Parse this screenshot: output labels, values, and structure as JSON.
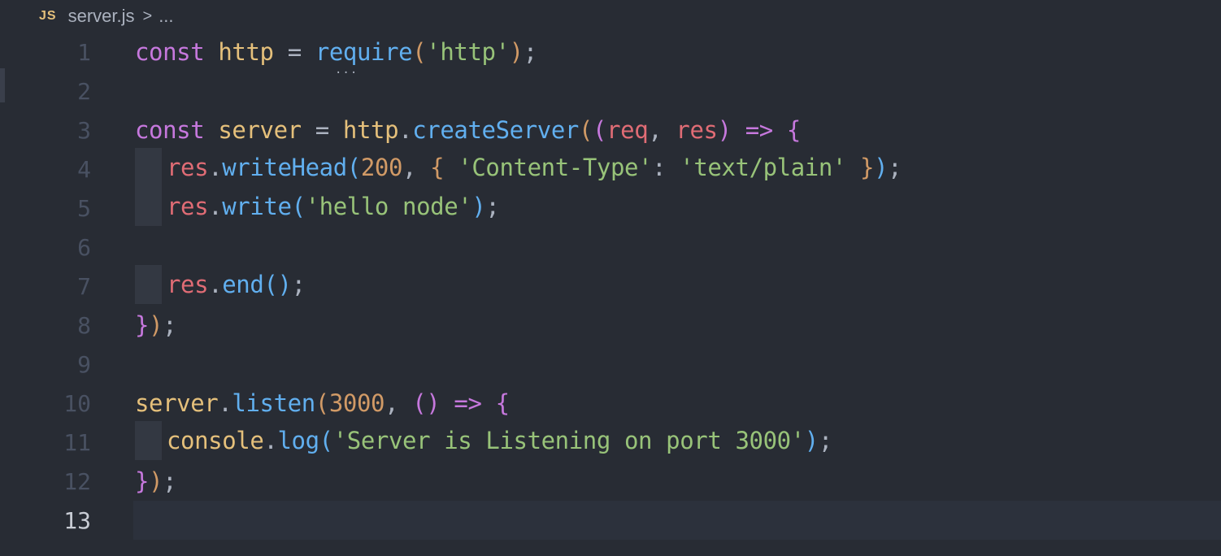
{
  "breadcrumb": {
    "file_icon": "JS",
    "file_name": "server.js",
    "separator": ">",
    "more": "..."
  },
  "editor": {
    "current_line": 13,
    "lines": [
      {
        "number": "1",
        "text": "const http = require('http');"
      },
      {
        "number": "2",
        "text": ""
      },
      {
        "number": "3",
        "text": "const server = http.createServer((req, res) => {"
      },
      {
        "number": "4",
        "text": "res.writeHead(200, { 'Content-Type': 'text/plain' });"
      },
      {
        "number": "5",
        "text": "res.write('hello node');"
      },
      {
        "number": "6",
        "text": ""
      },
      {
        "number": "7",
        "text": "res.end();"
      },
      {
        "number": "8",
        "text": "});"
      },
      {
        "number": "9",
        "text": ""
      },
      {
        "number": "10",
        "text": "server.listen(3000, () => {"
      },
      {
        "number": "11",
        "text": "console.log('Server is Listening on port 3000');"
      },
      {
        "number": "12",
        "text": "});"
      },
      {
        "number": "13",
        "text": ""
      }
    ],
    "hint_marker": "..."
  },
  "colors": {
    "background": "#282c34",
    "keyword": "#c678dd",
    "variable": "#e5c07b",
    "function": "#61afef",
    "string": "#98c379",
    "number": "#d19a66",
    "parameter": "#e06c75"
  }
}
